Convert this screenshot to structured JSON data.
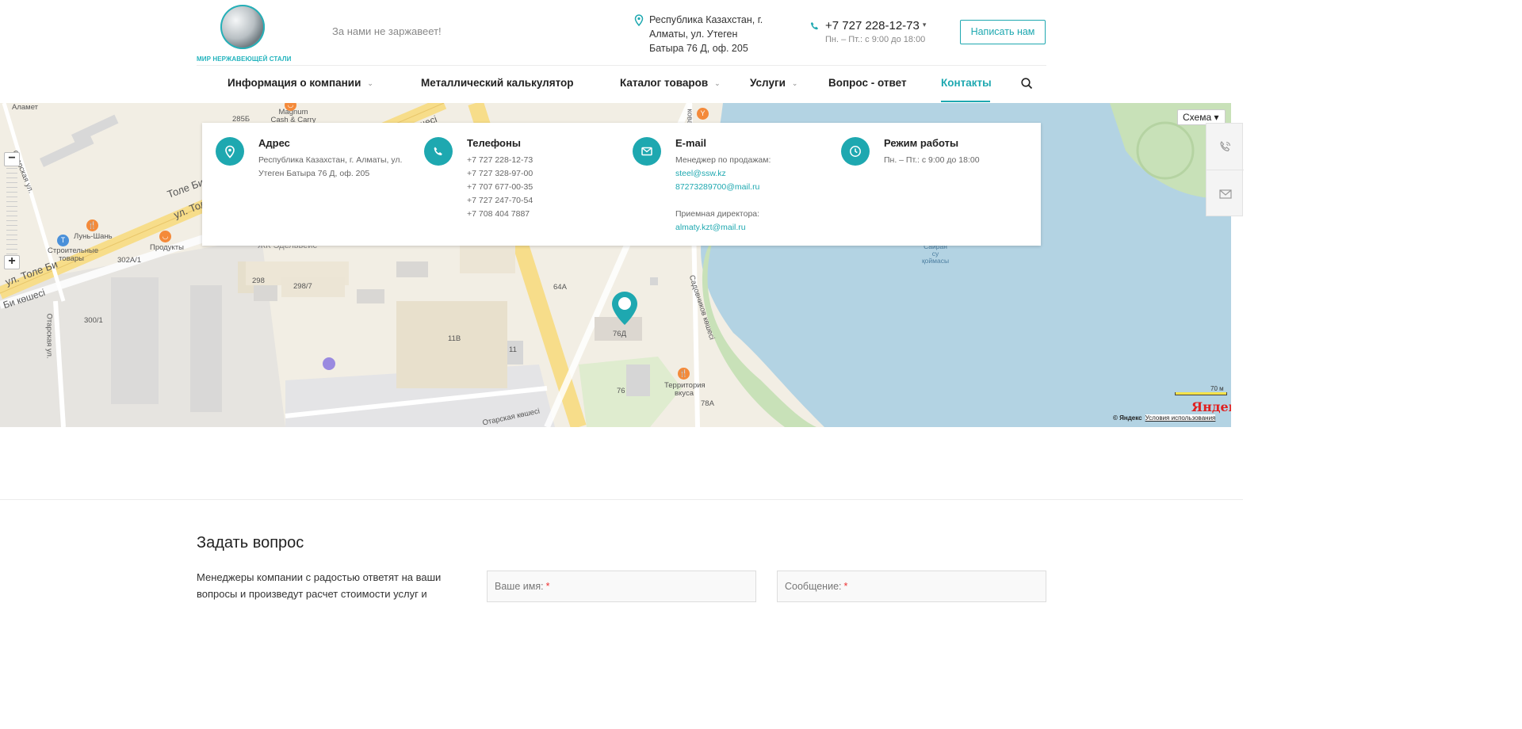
{
  "header": {
    "logo_text": "МИР НЕРЖАВЕЮЩЕЙ СТАЛИ",
    "slogan": "За нами не заржавеет!",
    "address": "Республика Казахстан, г. Алматы, ул. Утеген Батыра 76 Д, оф. 205",
    "phone": "+7 727 228-12-73",
    "hours": "Пн. – Пт.: с 9:00 до 18:00",
    "write_button": "Написать нам",
    "accent": "#1ea8b0"
  },
  "nav": {
    "items": [
      {
        "label": "Информация о компании",
        "has_dropdown": true
      },
      {
        "label": "Металлический калькулятор",
        "has_dropdown": false
      },
      {
        "label": "Каталог товаров",
        "has_dropdown": true
      },
      {
        "label": "Услуги",
        "has_dropdown": true
      },
      {
        "label": "Вопрос - ответ",
        "has_dropdown": false
      },
      {
        "label": "Контакты",
        "has_dropdown": false,
        "active": true
      }
    ],
    "search_icon": "search-icon"
  },
  "map": {
    "scheme_button": "Схема ▾",
    "scale": "70 м",
    "logo": "Яндекс",
    "copyright": "© Яндекс",
    "terms_link": "Условия использования",
    "labels": {
      "alamet": "Аламет",
      "otarskaya1": "Отарская ул.",
      "num285b": "285Б",
      "magnum": "Magnum Cash & Carry",
      "tole1": "Толе Би",
      "tole2": "ул. Толе",
      "lun": "Лунь-Шань",
      "stroit": "Строительные товары",
      "produkty": "Продукты",
      "num302": "302А/1",
      "edelweiss": "ЖК Эдельвейс",
      "num298": "298",
      "num298_7": "298/7",
      "tole3": "ул. Толе Би",
      "bikoshesi": "Би көшесі",
      "num300": "300/1",
      "otarskaya2": "Отарская ул.",
      "num64a": "64А",
      "num11v": "11В",
      "num11": "11",
      "num76d": "76Д",
      "num76": "76",
      "territory": "Территория вкуса",
      "num78a": "78А",
      "sadovnikov": "Садовников көшесі",
      "otarskaya3": "Отарская көшесі",
      "sairan": "Сайран су қоймасы",
      "kosh1": "көшесі",
      "kova": "кова"
    }
  },
  "side_widget": {
    "call_icon": "phone-call-icon",
    "mail_icon": "mail-icon"
  },
  "contacts": {
    "address": {
      "title": "Адрес",
      "line1": "Республика Казахстан, г. Алматы, ул.",
      "line2": "Утеген Батыра 76 Д, оф. 205"
    },
    "phones": {
      "title": "Телефоны",
      "items": [
        "+7 727 228-12-73",
        "+7 727 328-97-00",
        "+7 707 677-00-35",
        "+7 727 247-70-54",
        "+7 708 404 7887"
      ]
    },
    "email": {
      "title": "E-mail",
      "sales_label": "Менеджер по продажам:",
      "sales_emails": [
        "steel@ssw.kz",
        "87273289700@mail.ru"
      ],
      "director_label": "Приемная директора:",
      "director_email": "almaty.kzt@mail.ru"
    },
    "hours": {
      "title": "Режим работы",
      "line": "Пн. – Пт.: с 9:00 до 18:00"
    }
  },
  "question": {
    "title": "Задать вопрос",
    "text": "Менеджеры компании с радостью ответят на ваши вопросы и произведут расчет стоимости услуг и",
    "name_field": "Ваше имя:",
    "message_field": "Сообщение:",
    "required_mark": "*"
  }
}
